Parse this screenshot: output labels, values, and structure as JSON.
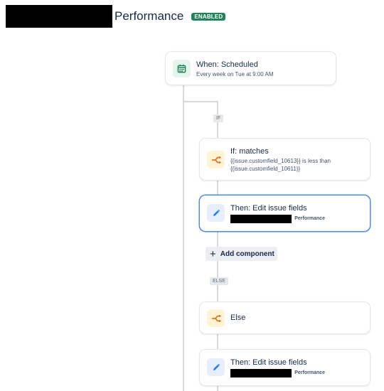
{
  "header": {
    "title": "Performance",
    "status_badge": "ENABLED"
  },
  "trigger": {
    "title": "When: Scheduled",
    "subtitle": "Every week on Tue at 9:00 AM",
    "icon": "calendar-icon"
  },
  "if_branch": {
    "label": "IF",
    "condition": {
      "title": "If: matches",
      "line1": "{{issue.customfield_10613}} is less than",
      "line2": "{{issue.customfield_10611}}",
      "icon": "branch-icon"
    },
    "action": {
      "title": "Then: Edit issue fields",
      "field_suffix": "Performance",
      "icon": "pencil-icon"
    },
    "add_component_label": "Add component"
  },
  "else_branch": {
    "label": "ELSE",
    "condition": {
      "title": "Else",
      "icon": "branch-icon"
    },
    "action": {
      "title": "Then: Edit issue fields",
      "field_suffix": "Performance",
      "icon": "pencil-icon"
    }
  },
  "colors": {
    "badge": "#1f845a",
    "selected_border": "#4c8ee8",
    "connector": "#d6d9de"
  }
}
